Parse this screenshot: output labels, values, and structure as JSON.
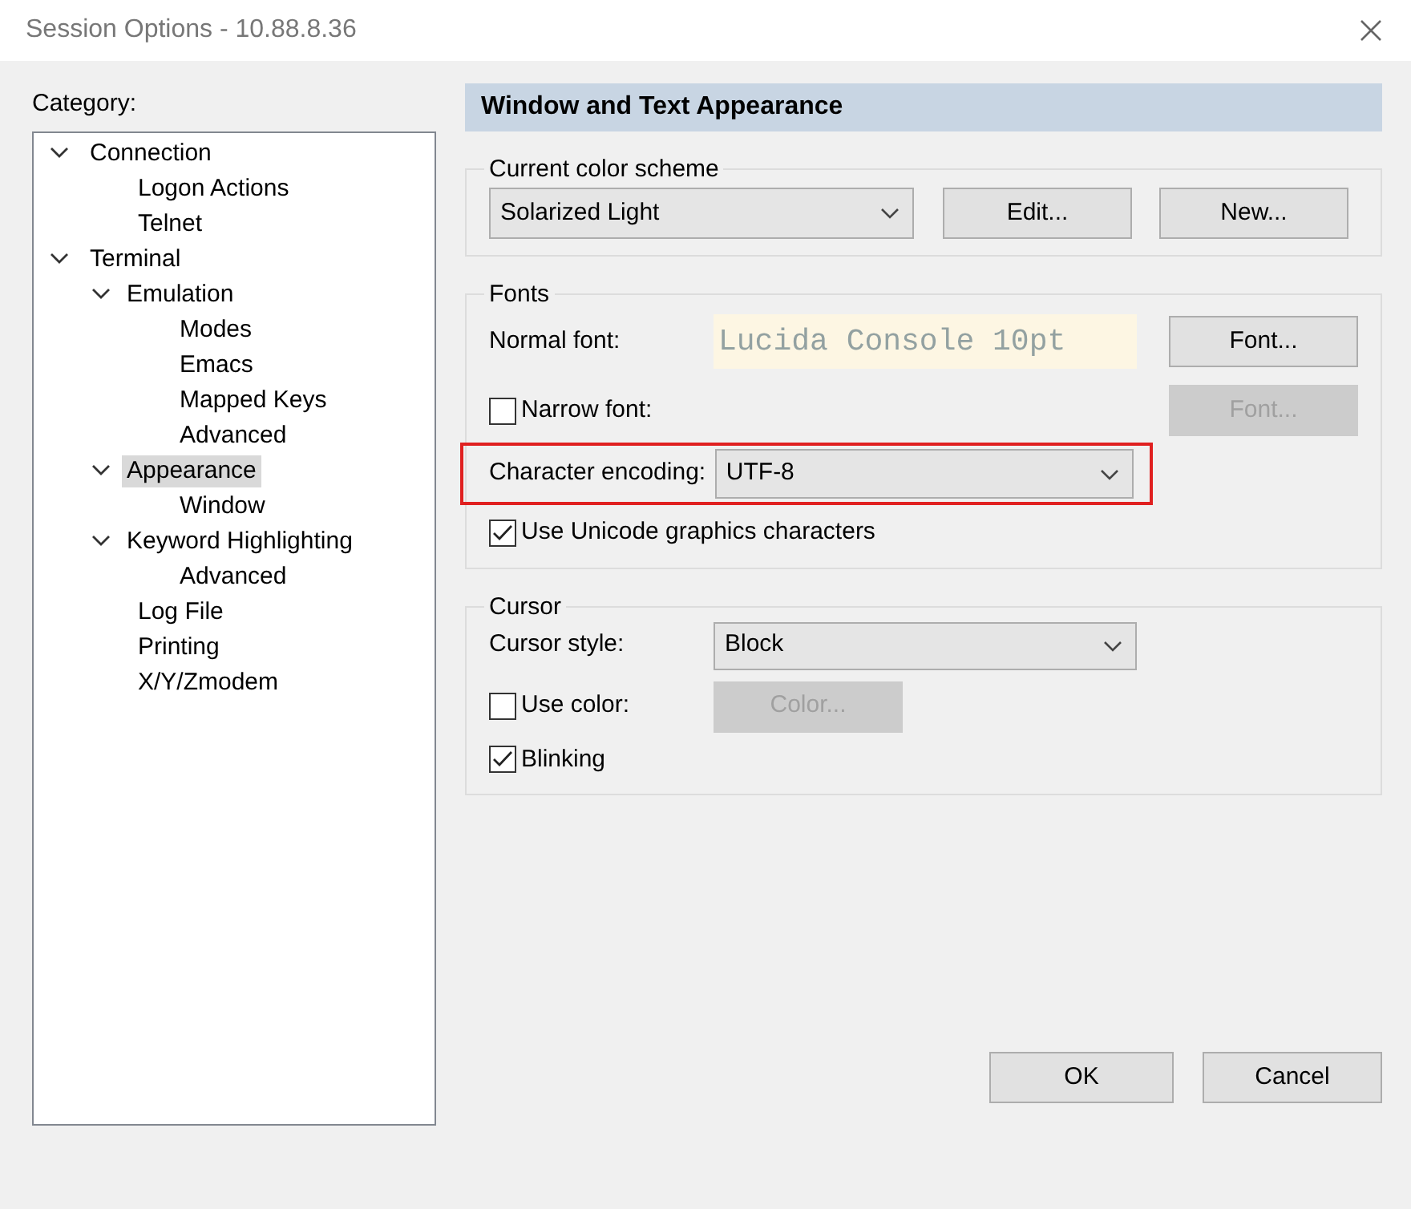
{
  "window": {
    "title": "Session Options - 10.88.8.36"
  },
  "category_label": "Category:",
  "tree": [
    {
      "label": "Connection",
      "selected": false,
      "expanded": true,
      "children": [
        {
          "label": "Logon Actions",
          "selected": false
        },
        {
          "label": "Telnet",
          "selected": false
        }
      ]
    },
    {
      "label": "Terminal",
      "selected": false,
      "expanded": true,
      "children": [
        {
          "label": "Emulation",
          "selected": false,
          "expanded": true,
          "children": [
            {
              "label": "Modes",
              "selected": false
            },
            {
              "label": "Emacs",
              "selected": false
            },
            {
              "label": "Mapped Keys",
              "selected": false
            },
            {
              "label": "Advanced",
              "selected": false
            }
          ]
        },
        {
          "label": "Appearance",
          "selected": true,
          "expanded": true,
          "children": [
            {
              "label": "Window",
              "selected": false
            }
          ]
        },
        {
          "label": "Keyword Highlighting",
          "selected": false,
          "expanded": true,
          "children": [
            {
              "label": "Advanced",
              "selected": false
            }
          ]
        },
        {
          "label": "Log File",
          "selected": false
        },
        {
          "label": "Printing",
          "selected": false
        },
        {
          "label": "X/Y/Zmodem",
          "selected": false
        }
      ]
    }
  ],
  "panel": {
    "title": "Window and Text Appearance"
  },
  "color_scheme": {
    "legend": "Current color scheme",
    "dropdown": {
      "value": "Solarized Light"
    },
    "buttons": [
      {
        "label": "Edit...",
        "disabled": false
      },
      {
        "label": "New...",
        "disabled": false
      }
    ]
  },
  "fonts": {
    "legend": "Fonts",
    "normal_font": {
      "label": "Normal font:",
      "value": "Lucida Console 10pt"
    },
    "font_button": {
      "label": "Font...",
      "disabled": false
    },
    "narrow_font": {
      "label": "Narrow font:",
      "checked": false
    },
    "narrow_button": {
      "label": "Font...",
      "disabled": true
    },
    "encoding": {
      "label": "Character encoding:",
      "value": "UTF-8",
      "highlighted": true
    },
    "unicode": {
      "label": "Use Unicode graphics characters",
      "checked": true
    }
  },
  "cursor": {
    "legend": "Cursor",
    "style": {
      "label": "Cursor style:",
      "value": "Block"
    },
    "use_color": {
      "label": "Use color:",
      "checked": false
    },
    "color_button": {
      "label": "Color...",
      "disabled": true
    },
    "blinking": {
      "label": "Blinking",
      "checked": true
    }
  },
  "buttons": [
    {
      "label": "OK"
    },
    {
      "label": "Cancel"
    }
  ]
}
